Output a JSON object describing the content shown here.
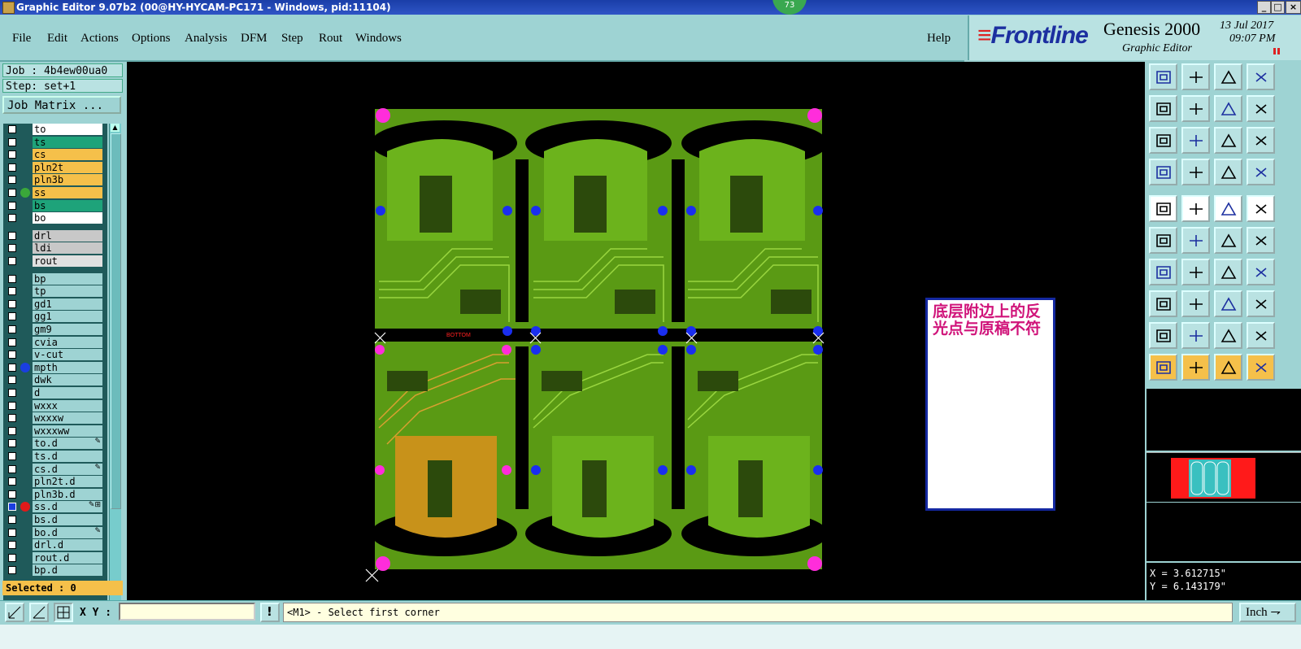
{
  "window": {
    "title": "Graphic Editor 9.07b2 (00@HY-HYCAM-PC171 - Windows, pid:11104)",
    "badge": "73"
  },
  "menu": {
    "file": "File",
    "edit": "Edit",
    "actions": "Actions",
    "options": "Options",
    "analysis": "Analysis",
    "dfm": "DFM",
    "step": "Step",
    "rout": "Rout",
    "windows": "Windows",
    "help": "Help"
  },
  "brand": {
    "logo": "Frontline",
    "product": "Genesis 2000",
    "subtitle": "Graphic Editor",
    "date": "13 Jul 2017",
    "time": "09:07 PM"
  },
  "job": {
    "job_label": "Job : 4b4ew00ua0",
    "step_label": "Step: set+1",
    "matrix_button": "Job Matrix ..."
  },
  "layers": [
    {
      "name": "to",
      "bg": "#ffffff"
    },
    {
      "name": "ts",
      "bg": "#1ea37a"
    },
    {
      "name": "cs",
      "bg": "#f5c04a"
    },
    {
      "name": "pln2t",
      "bg": "#f5c04a"
    },
    {
      "name": "pln3b",
      "bg": "#f5c04a"
    },
    {
      "name": "ss",
      "bg": "#f5c04a",
      "dot": "#3aa83a"
    },
    {
      "name": "bs",
      "bg": "#1ea37a"
    },
    {
      "name": "bo",
      "bg": "#ffffff"
    },
    {
      "name": "drl",
      "bg": "#c8c8c8",
      "gap": true
    },
    {
      "name": "ldi",
      "bg": "#c8c8c8"
    },
    {
      "name": "rout",
      "bg": "#e0e0e0"
    },
    {
      "name": "bp",
      "bg": "#9ed3d3",
      "gap": true
    },
    {
      "name": "tp",
      "bg": "#9ed3d3"
    },
    {
      "name": "gd1",
      "bg": "#9ed3d3"
    },
    {
      "name": "gg1",
      "bg": "#9ed3d3"
    },
    {
      "name": "gm9",
      "bg": "#9ed3d3"
    },
    {
      "name": "cvia",
      "bg": "#9ed3d3"
    },
    {
      "name": "v-cut",
      "bg": "#9ed3d3"
    },
    {
      "name": "mpth",
      "bg": "#9ed3d3",
      "dot": "#1a3ee0"
    },
    {
      "name": "dwk",
      "bg": "#9ed3d3"
    },
    {
      "name": "d",
      "bg": "#9ed3d3"
    },
    {
      "name": "wxxx",
      "bg": "#9ed3d3"
    },
    {
      "name": "wxxxw",
      "bg": "#9ed3d3"
    },
    {
      "name": "wxxxww",
      "bg": "#9ed3d3"
    },
    {
      "name": "to.d",
      "bg": "#9ed3d3",
      "mark": "✎"
    },
    {
      "name": "ts.d",
      "bg": "#9ed3d3"
    },
    {
      "name": "cs.d",
      "bg": "#9ed3d3",
      "mark": "✎"
    },
    {
      "name": "pln2t.d",
      "bg": "#9ed3d3"
    },
    {
      "name": "pln3b.d",
      "bg": "#9ed3d3"
    },
    {
      "name": "ss.d",
      "bg": "#9ed3d3",
      "dot": "#e01a1a",
      "mark": "✎⊞",
      "active": true
    },
    {
      "name": "bs.d",
      "bg": "#9ed3d3"
    },
    {
      "name": "bo.d",
      "bg": "#9ed3d3",
      "mark": "✎"
    },
    {
      "name": "drl.d",
      "bg": "#9ed3d3"
    },
    {
      "name": "rout.d",
      "bg": "#9ed3d3"
    },
    {
      "name": "bp.d",
      "bg": "#9ed3d3"
    }
  ],
  "selected": "Selected : 0",
  "canvas": {
    "board_label": "BOTTOM",
    "annotation": "底层附边上的反光点与原稿不符"
  },
  "coords": {
    "x": "X = 3.612715\"",
    "y": "Y = 6.143179\""
  },
  "bottom": {
    "xy_label": "X Y :",
    "xy_value": "",
    "prompt": "<M1> - Select first corner",
    "units": "Inch"
  },
  "colors": {
    "board": "#5a9a14",
    "trace": "#6cb31c",
    "copper_gold": "#c8921a",
    "pad_magenta": "#ff2ddb",
    "pad_blue": "#1a2ef0",
    "annotation_text": "#d0147a"
  }
}
